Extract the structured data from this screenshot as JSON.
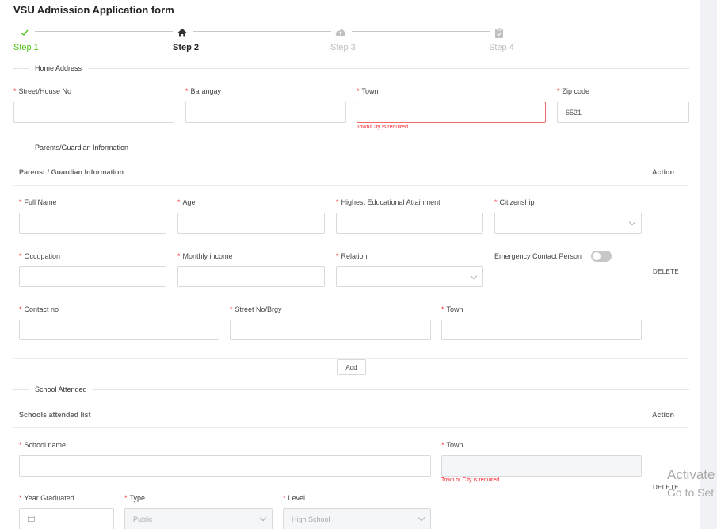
{
  "form": {
    "title": "VSU Admission Application form"
  },
  "steps": [
    {
      "label": "Step 1",
      "icon": "check-icon",
      "state": "done"
    },
    {
      "label": "Step 2",
      "icon": "home-icon",
      "state": "current"
    },
    {
      "label": "Step 3",
      "icon": "cloud-upload-icon",
      "state": "pending"
    },
    {
      "label": "Step 4",
      "icon": "clipboard-check-icon",
      "state": "pending"
    }
  ],
  "colors": {
    "success": "#52c41a",
    "error": "#f5222d",
    "pending": "#bfbfbf"
  },
  "home_address": {
    "section_title": "Home Address",
    "street_label": "Street/House No",
    "barangay_label": "Barangay",
    "town_label": "Town",
    "town_error": "Town/City is required",
    "zip_label": "Zip code",
    "zip_value": "6521"
  },
  "parents": {
    "section_title": "Parents/Guardian Information",
    "table_title": "Parenst / Guardian Information",
    "action_label": "Action",
    "full_name_label": "Full Name",
    "age_label": "Age",
    "education_label": "Highest Educational Attainment",
    "citizenship_label": "Citizenship",
    "occupation_label": "Occupation",
    "income_label": "Monthly income",
    "relation_label": "Relation",
    "emergency_label": "Emergency Contact Person",
    "emergency_on": false,
    "delete_label": "DELETE",
    "contact_label": "Contact no",
    "street_label": "Street No/Brgy",
    "town_label": "Town",
    "add_label": "Add"
  },
  "school": {
    "section_title": "School Attended",
    "table_title": "Schools attended list",
    "action_label": "Action",
    "name_label": "School name",
    "town_label": "Town",
    "town_error": "Town or City is required",
    "delete_label": "DELETE",
    "year_label": "Year Graduated",
    "type_label": "Type",
    "type_value": "Public",
    "level_label": "Level",
    "level_value": "High School"
  },
  "watermark": {
    "line1": "Activate",
    "line2": "Go to Set"
  }
}
